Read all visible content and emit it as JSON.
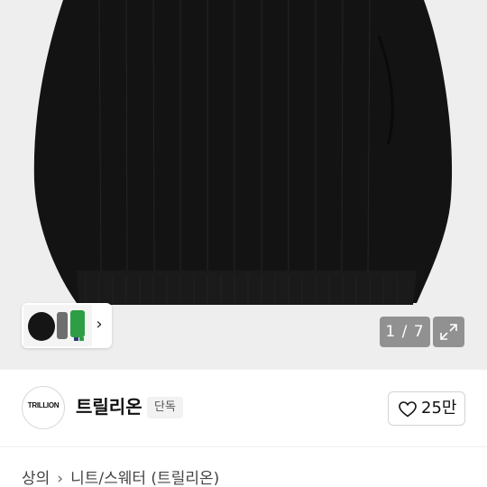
{
  "gallery": {
    "current_page": "1",
    "total_pages": "7",
    "page_indicator": "1 / 7",
    "thumbnail_arrow": "›"
  },
  "store": {
    "logo_text": "TRILLION",
    "name": "트릴리온",
    "badge": "단독",
    "like_count": "25만"
  },
  "breadcrumb": {
    "items": [
      "상의",
      "니트/스웨터 (트릴리온)"
    ],
    "separator": "›"
  },
  "colors": {
    "hero_background": "#eeeeee",
    "sweater": "#111111",
    "thumb_green": "#2e9e45",
    "thumb_gray": "#6e6e6e"
  }
}
